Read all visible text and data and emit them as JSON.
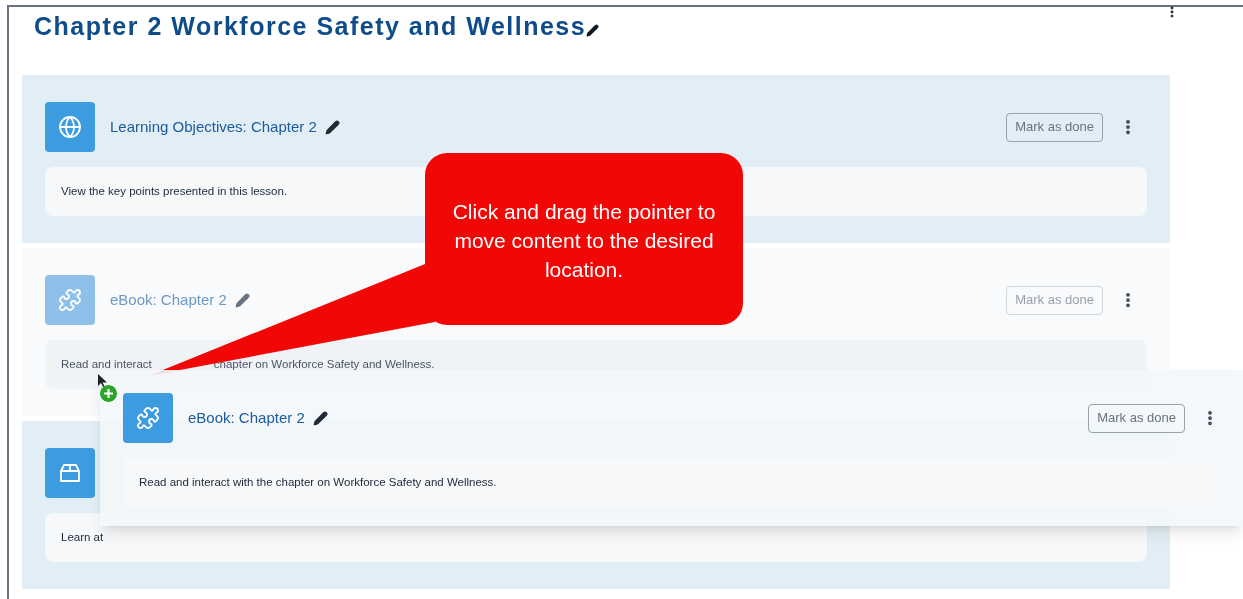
{
  "title": "Chapter 2 Workforce Safety and Wellness",
  "activities": [
    {
      "kind": "globe",
      "title": "Learning Objectives: Chapter 2",
      "description": "View the key points presented in this lesson.",
      "button": "Mark as done",
      "dragging": false
    },
    {
      "kind": "puzzle",
      "title": "eBook: Chapter 2",
      "description": "Read and interact",
      "description_after_tail": "chapter on Workforce Safety and Wellness.",
      "button": "Mark as done",
      "dragging": true
    },
    {
      "kind": "box",
      "description": "Learn at",
      "dragging": false
    }
  ],
  "drag_preview": {
    "kind": "puzzle",
    "title": "eBook: Chapter 2",
    "description": "Read and interact with the chapter on Workforce Safety and Wellness.",
    "button": "Mark as done"
  },
  "callout": {
    "text": "Click and drag the pointer to move content to the desired location."
  }
}
